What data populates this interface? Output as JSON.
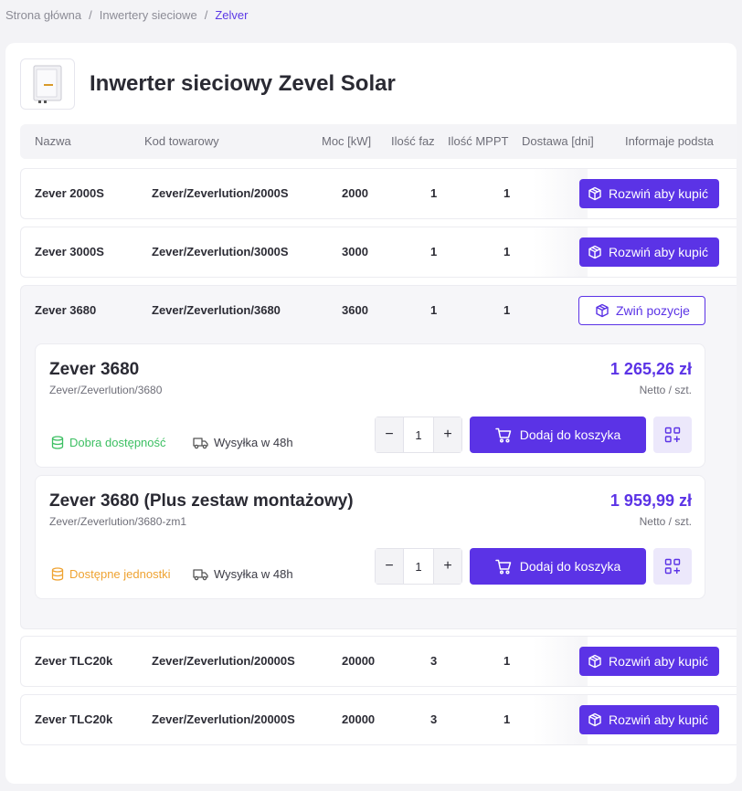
{
  "breadcrumb": {
    "home": "Strona główna",
    "category": "Inwertery sieciowe",
    "current": "Zelver",
    "separator": "/"
  },
  "page": {
    "title": "Inwerter sieciowy Zevel Solar"
  },
  "columns": {
    "name": "Nazwa",
    "code": "Kod towarowy",
    "power": "Moc [kW]",
    "phases": "Ilość faz",
    "mppt": "Ilość MPPT",
    "delivery": "Dostawa [dni]",
    "info": "Informaje podsta"
  },
  "rows": [
    {
      "name": "Zever 2000S",
      "code": "Zever/Zeverlution/2000S",
      "power": "2000",
      "phases": "1",
      "mppt": "1",
      "action": "Rozwiń aby kupić"
    },
    {
      "name": "Zever 3000S",
      "code": "Zever/Zeverlution/3000S",
      "power": "3000",
      "phases": "1",
      "mppt": "1",
      "action": "Rozwiń aby kupić"
    },
    {
      "name": "Zever TLC20k",
      "code": "Zever/Zeverlution/20000S",
      "power": "20000",
      "phases": "3",
      "mppt": "1",
      "action": "Rozwiń aby kupić"
    },
    {
      "name": "Zever TLC20k",
      "code": "Zever/Zeverlution/20000S",
      "power": "20000",
      "phases": "3",
      "mppt": "1",
      "action": "Rozwiń aby kupić"
    }
  ],
  "expanded": {
    "name": "Zever 3680",
    "code": "Zever/Zeverlution/3680",
    "power": "3600",
    "phases": "1",
    "mppt": "1",
    "collapse_label": "Zwiń pozycje",
    "variants": [
      {
        "name": "Zever 3680",
        "code": "Zever/Zeverlution/3680",
        "price": "1 265,26 zł",
        "unit": "Netto / szt.",
        "availability": "Dobra dostępność",
        "availability_color": "#3cbf62",
        "shipping": "Wysyłka w 48h",
        "quantity": "1",
        "add_label": "Dodaj do koszyka"
      },
      {
        "name": "Zever 3680 (Plus zestaw montażowy)",
        "code": "Zever/Zeverlution/3680-zm1",
        "price": "1 959,99 zł",
        "unit": "Netto / szt.",
        "availability": "Dostępne jednostki",
        "availability_color": "#efa332",
        "shipping": "Wysyłka w 48h",
        "quantity": "1",
        "add_label": "Dodaj do koszyka"
      }
    ]
  },
  "qty_controls": {
    "minus": "−",
    "plus": "+"
  },
  "colors": {
    "accent": "#5b33e6",
    "accent_light": "#ece8fb"
  },
  "icons": {
    "expand": "box-icon",
    "cart": "cart-icon",
    "more": "grid-plus-icon",
    "availability": "database-icon",
    "shipping": "truck-icon"
  }
}
